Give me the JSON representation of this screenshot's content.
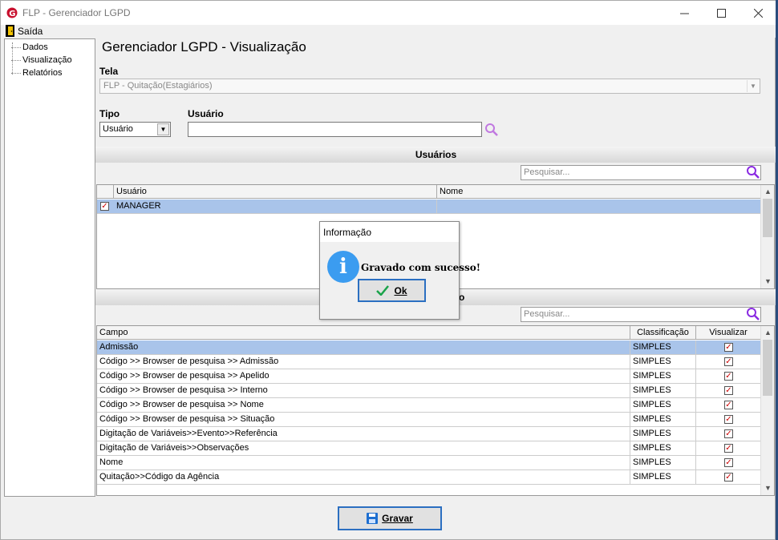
{
  "window": {
    "title": "FLP - Gerenciador LGPD"
  },
  "menu": {
    "exit_label": "Saída"
  },
  "tree": {
    "items": [
      "Dados",
      "Visualização",
      "Relatórios"
    ]
  },
  "page": {
    "heading": "Gerenciador LGPD - Visualização"
  },
  "form": {
    "tela_label": "Tela",
    "tela_value": "FLP - Quitação(Estagiários)",
    "tipo_label": "Tipo",
    "tipo_value": "Usuário",
    "usuario_label": "Usuário",
    "usuario_value": ""
  },
  "usuarios": {
    "section_title": "Usuários",
    "search_placeholder": "Pesquisar...",
    "columns": [
      "Usuário",
      "Nome"
    ],
    "rows": [
      {
        "checked": true,
        "usuario": "MANAGER",
        "nome": ""
      }
    ]
  },
  "campos": {
    "section_title_partial": "o",
    "search_placeholder": "Pesquisar...",
    "columns": [
      "Campo",
      "Classificação",
      "Visualizar"
    ],
    "rows": [
      {
        "campo": "Admissão",
        "classificacao": "SIMPLES",
        "visualizar": true
      },
      {
        "campo": "Código >> Browser de pesquisa >> Admissão",
        "classificacao": "SIMPLES",
        "visualizar": true
      },
      {
        "campo": "Código >> Browser de pesquisa >> Apelido",
        "classificacao": "SIMPLES",
        "visualizar": true
      },
      {
        "campo": "Código >> Browser de pesquisa >> Interno",
        "classificacao": "SIMPLES",
        "visualizar": true
      },
      {
        "campo": "Código >> Browser de pesquisa >> Nome",
        "classificacao": "SIMPLES",
        "visualizar": true
      },
      {
        "campo": "Código >> Browser de pesquisa >> Situação",
        "classificacao": "SIMPLES",
        "visualizar": true
      },
      {
        "campo": "Digitação de Variáveis>>Evento>>Referência",
        "classificacao": "SIMPLES",
        "visualizar": true
      },
      {
        "campo": "Digitação de Variáveis>>Observações",
        "classificacao": "SIMPLES",
        "visualizar": true
      },
      {
        "campo": "Nome",
        "classificacao": "SIMPLES",
        "visualizar": true
      },
      {
        "campo": "Quitação>>Código da Agência",
        "classificacao": "SIMPLES",
        "visualizar": true
      }
    ]
  },
  "actions": {
    "save_label": "Gravar"
  },
  "dialog": {
    "title": "Informação",
    "message": "Gravado com sucesso!",
    "ok_label": "Ok",
    "icon": "info-icon"
  },
  "colors": {
    "selection": "#a9c4ea",
    "accent": "#2b6fc1",
    "check": "#cc0000",
    "search_icon": "#8a2be2"
  }
}
